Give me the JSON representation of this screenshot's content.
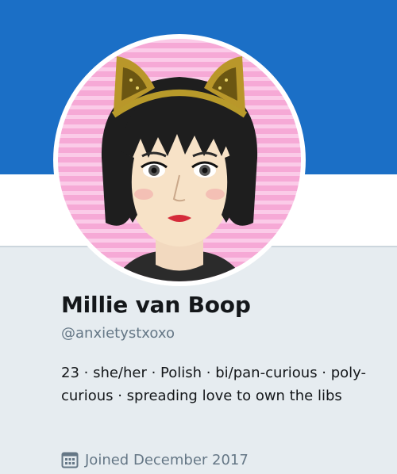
{
  "profile": {
    "display_name": "Millie van Boop",
    "handle": "@anxietystxoxo",
    "bio": "23 · she/her · Polish · bi/pan-curious · poly-curious · spreading love to own the libs",
    "joined": "Joined December 2017",
    "avatar_icon": "cartoon-avatar-cat-ears"
  },
  "colors": {
    "banner": "#1b6fc6",
    "background": "#e6ecf0",
    "secondary_text": "#657786",
    "primary_text": "#14171a"
  }
}
